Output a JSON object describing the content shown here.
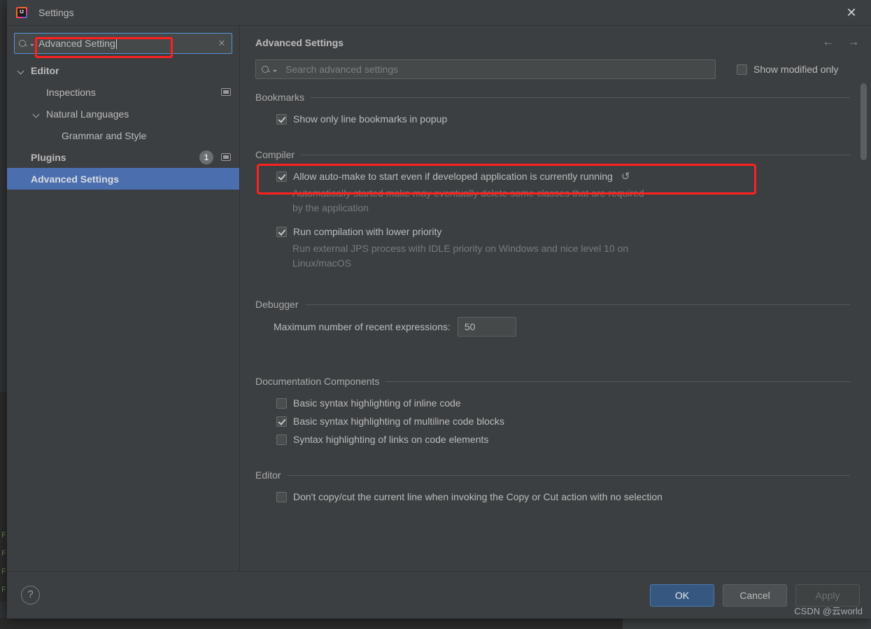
{
  "window": {
    "title": "Settings",
    "app_icon": "intellij-idea-icon",
    "close_icon": "close-icon"
  },
  "sidebar": {
    "search": {
      "value": "Advanced Setting",
      "search_icon": "search-icon",
      "clear_icon": "clear-icon"
    },
    "items": [
      {
        "label": "Editor",
        "indent": 0,
        "arrow": true,
        "bold": true,
        "selected": false,
        "badge": null,
        "copy_icon": false
      },
      {
        "label": "Inspections",
        "indent": 1,
        "arrow": false,
        "bold": false,
        "selected": false,
        "badge": null,
        "copy_icon": true
      },
      {
        "label": "Natural Languages",
        "indent": 1,
        "arrow": true,
        "bold": false,
        "selected": false,
        "badge": null,
        "copy_icon": false
      },
      {
        "label": "Grammar and Style",
        "indent": 2,
        "arrow": false,
        "bold": false,
        "selected": false,
        "badge": null,
        "copy_icon": false
      },
      {
        "label": "Plugins",
        "indent": 0,
        "arrow": false,
        "bold": true,
        "selected": false,
        "badge": "1",
        "copy_icon": true
      },
      {
        "label": "Advanced Settings",
        "indent": 0,
        "arrow": false,
        "bold": true,
        "selected": true,
        "badge": null,
        "copy_icon": false
      }
    ]
  },
  "content": {
    "title": "Advanced Settings",
    "nav_back_icon": "arrow-left-icon",
    "nav_forward_icon": "arrow-right-icon",
    "search_placeholder": "Search advanced settings",
    "search_value": "",
    "modified_only": {
      "label": "Show modified only",
      "checked": false
    },
    "groups": [
      {
        "title": "Bookmarks",
        "rows": [
          {
            "type": "checkbox",
            "label": "Show only line bookmarks in popup",
            "checked": true,
            "revert": false,
            "desc": null
          }
        ]
      },
      {
        "title": "Compiler",
        "rows": [
          {
            "type": "checkbox",
            "label": "Allow auto-make to start even if developed application is currently running",
            "checked": true,
            "revert": true,
            "desc": "Automatically started make may eventually delete some classes that are required by the application"
          },
          {
            "type": "checkbox",
            "label": "Run compilation with lower priority",
            "checked": true,
            "revert": false,
            "desc": "Run external JPS process with IDLE priority on Windows and nice level 10 on Linux/macOS"
          }
        ]
      },
      {
        "title": "Debugger",
        "rows": [
          {
            "type": "spinner",
            "label": "Maximum number of recent expressions:",
            "value": "50"
          }
        ]
      },
      {
        "title": "Documentation Components",
        "rows": [
          {
            "type": "checkbox",
            "label": "Basic syntax highlighting of inline code",
            "checked": false,
            "revert": false,
            "desc": null
          },
          {
            "type": "checkbox",
            "label": "Basic syntax highlighting of multiline code blocks",
            "checked": true,
            "revert": false,
            "desc": null
          },
          {
            "type": "checkbox",
            "label": "Syntax highlighting of links on code elements",
            "checked": false,
            "revert": false,
            "desc": null
          }
        ]
      },
      {
        "title": "Editor",
        "rows": [
          {
            "type": "checkbox",
            "label": "Don't copy/cut the current line when invoking the Copy or Cut action with no selection",
            "checked": false,
            "revert": false,
            "desc": null
          }
        ]
      }
    ],
    "revert_icon": "revert-icon"
  },
  "footer": {
    "help_icon": "help-icon",
    "ok_label": "OK",
    "cancel_label": "Cancel",
    "apply_label": "Apply"
  },
  "watermark": "CSDN @云world",
  "colors": {
    "dialog_bg": "#3c3f41",
    "selection_blue": "#4b6eaf",
    "primary_button": "#365880",
    "annotation_red": "#ff2020",
    "focus_border": "#5394d4"
  }
}
